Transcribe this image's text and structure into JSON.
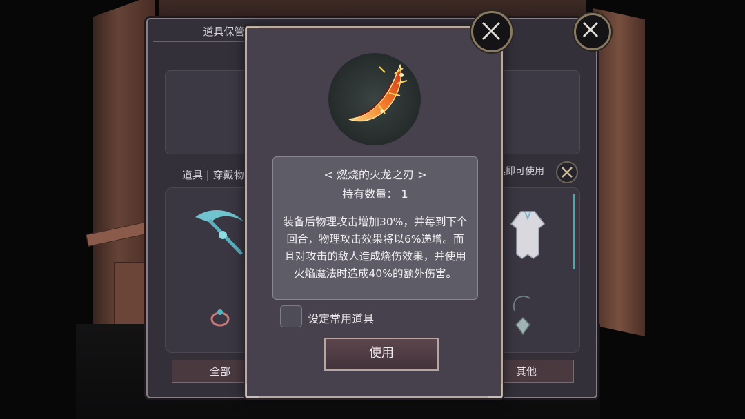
{
  "back_panel": {
    "title": "道具保管箱",
    "tabs_label": "道具 | 穿戴物",
    "hint": "具即可使用",
    "bottom_tabs": {
      "all": "全部",
      "other": "其他"
    }
  },
  "dialog": {
    "item_name": "< 燃烧的火龙之刃 >",
    "count_label": "持有数量： 1",
    "description": "装备后物理攻击增加30%，并每到下个回合，物理攻击效果将以6%递增。而且对攻击的敌人造成烧伤效果，并使用火焰魔法时造成40%的额外伤害。",
    "checkbox_label": "设定常用道具",
    "use_button": "使用"
  },
  "icons": {
    "close": "close-icon",
    "item": "flame-blade-icon",
    "back_item_1": "ice-scythe-icon",
    "back_item_2": "ring-icon",
    "back_item_3": "robe-icon",
    "back_item_4": "amulet-icon"
  },
  "colors": {
    "panel": "#33303a",
    "dialog": "#46414c",
    "frame_gold": "#b9a99e",
    "fire": "#f08a2a"
  }
}
